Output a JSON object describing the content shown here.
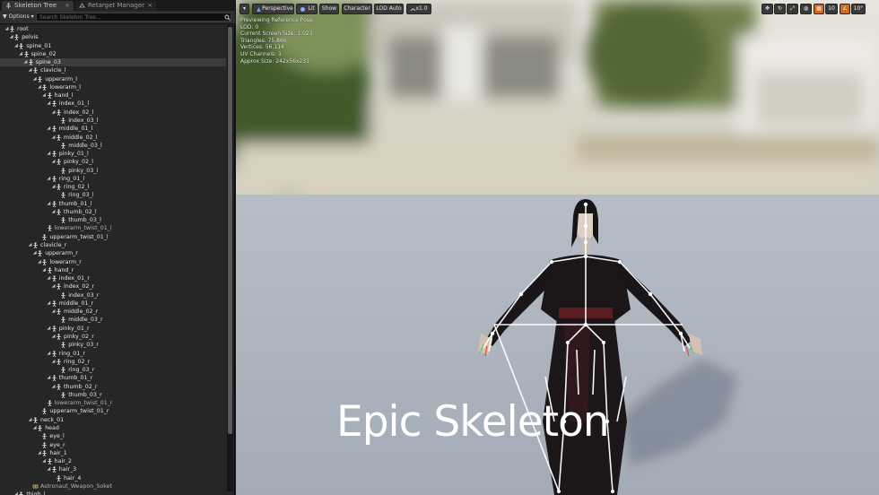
{
  "tabs": [
    {
      "label": "Skeleton Tree",
      "icon": "skeleton-tree-icon"
    },
    {
      "label": "Retarget Manager",
      "icon": "retarget-icon"
    }
  ],
  "toolbar": {
    "options_label": "Options",
    "search_placeholder": "Search Skeleton Tree..."
  },
  "tree": [
    {
      "label": "root",
      "depth": 0,
      "arrow": "open"
    },
    {
      "label": "pelvis",
      "depth": 1,
      "arrow": "open"
    },
    {
      "label": "spine_01",
      "depth": 2,
      "arrow": "open"
    },
    {
      "label": "spine_02",
      "depth": 3,
      "arrow": "open"
    },
    {
      "label": "spine_03",
      "depth": 4,
      "arrow": "open",
      "selected": true
    },
    {
      "label": "clavicle_l",
      "depth": 5,
      "arrow": "open"
    },
    {
      "label": "upperarm_l",
      "depth": 6,
      "arrow": "open"
    },
    {
      "label": "lowerarm_l",
      "depth": 7,
      "arrow": "open"
    },
    {
      "label": "hand_l",
      "depth": 8,
      "arrow": "open"
    },
    {
      "label": "index_01_l",
      "depth": 9,
      "arrow": "open"
    },
    {
      "label": "index_02_l",
      "depth": 10,
      "arrow": "open"
    },
    {
      "label": "index_03_l",
      "depth": 11,
      "arrow": "none"
    },
    {
      "label": "middle_01_l",
      "depth": 9,
      "arrow": "open"
    },
    {
      "label": "middle_02_l",
      "depth": 10,
      "arrow": "open"
    },
    {
      "label": "middle_03_l",
      "depth": 11,
      "arrow": "none"
    },
    {
      "label": "pinky_01_l",
      "depth": 9,
      "arrow": "open"
    },
    {
      "label": "pinky_02_l",
      "depth": 10,
      "arrow": "open"
    },
    {
      "label": "pinky_03_l",
      "depth": 11,
      "arrow": "none"
    },
    {
      "label": "ring_01_l",
      "depth": 9,
      "arrow": "open"
    },
    {
      "label": "ring_02_l",
      "depth": 10,
      "arrow": "open"
    },
    {
      "label": "ring_03_l",
      "depth": 11,
      "arrow": "none"
    },
    {
      "label": "thumb_01_l",
      "depth": 9,
      "arrow": "open"
    },
    {
      "label": "thumb_02_l",
      "depth": 10,
      "arrow": "open"
    },
    {
      "label": "thumb_03_l",
      "depth": 11,
      "arrow": "none"
    },
    {
      "label": "lowerarm_twist_01_l",
      "depth": 8,
      "arrow": "none",
      "dim": true
    },
    {
      "label": "upperarm_twist_01_l",
      "depth": 7,
      "arrow": "none"
    },
    {
      "label": "clavicle_r",
      "depth": 5,
      "arrow": "open"
    },
    {
      "label": "upperarm_r",
      "depth": 6,
      "arrow": "open"
    },
    {
      "label": "lowerarm_r",
      "depth": 7,
      "arrow": "open"
    },
    {
      "label": "hand_r",
      "depth": 8,
      "arrow": "open"
    },
    {
      "label": "index_01_r",
      "depth": 9,
      "arrow": "open"
    },
    {
      "label": "index_02_r",
      "depth": 10,
      "arrow": "open"
    },
    {
      "label": "index_03_r",
      "depth": 11,
      "arrow": "none"
    },
    {
      "label": "middle_01_r",
      "depth": 9,
      "arrow": "open"
    },
    {
      "label": "middle_02_r",
      "depth": 10,
      "arrow": "open"
    },
    {
      "label": "middle_03_r",
      "depth": 11,
      "arrow": "none"
    },
    {
      "label": "pinky_01_r",
      "depth": 9,
      "arrow": "open"
    },
    {
      "label": "pinky_02_r",
      "depth": 10,
      "arrow": "open"
    },
    {
      "label": "pinky_03_r",
      "depth": 11,
      "arrow": "none"
    },
    {
      "label": "ring_01_r",
      "depth": 9,
      "arrow": "open"
    },
    {
      "label": "ring_02_r",
      "depth": 10,
      "arrow": "open"
    },
    {
      "label": "ring_03_r",
      "depth": 11,
      "arrow": "none"
    },
    {
      "label": "thumb_01_r",
      "depth": 9,
      "arrow": "open"
    },
    {
      "label": "thumb_02_r",
      "depth": 10,
      "arrow": "open"
    },
    {
      "label": "thumb_03_r",
      "depth": 11,
      "arrow": "none"
    },
    {
      "label": "lowerarm_twist_01_r",
      "depth": 8,
      "arrow": "none",
      "dim": true
    },
    {
      "label": "upperarm_twist_01_r",
      "depth": 7,
      "arrow": "none"
    },
    {
      "label": "neck_01",
      "depth": 5,
      "arrow": "open"
    },
    {
      "label": "head",
      "depth": 6,
      "arrow": "open"
    },
    {
      "label": "eye_l",
      "depth": 7,
      "arrow": "none"
    },
    {
      "label": "eye_r",
      "depth": 7,
      "arrow": "none"
    },
    {
      "label": "hair_1",
      "depth": 7,
      "arrow": "open"
    },
    {
      "label": "hair_2",
      "depth": 8,
      "arrow": "open"
    },
    {
      "label": "hair_3",
      "depth": 9,
      "arrow": "open"
    },
    {
      "label": "hair_4",
      "depth": 10,
      "arrow": "none"
    },
    {
      "label": "Astronaut_Weapon_Soket",
      "depth": 5,
      "arrow": "none",
      "dim": true,
      "socket": true
    },
    {
      "label": "thigh_l",
      "depth": 2,
      "arrow": "open"
    }
  ],
  "viewport": {
    "perspective_label": "Perspective",
    "lit_label": "Lit",
    "show_label": "Show",
    "character_label": "Character",
    "lod_label": "LOD Auto",
    "speed_label": "x1.0",
    "info": [
      "Previewing Reference Pose",
      "LOD: 0",
      "Current Screen Size: 1.023",
      "Triangles: 75,866",
      "Vertices: 56,114",
      "UV Channels: 1",
      "Approx Size: 242x56x231"
    ],
    "grid_value": "10",
    "angle_value": "10°",
    "overlay_text": "Epic Skeleton"
  },
  "colors": {
    "panel_bg": "#262626",
    "selected_row": "#3c3c3c",
    "bone_icon": "#d8d8d8",
    "grid_snap_orange": "#d66a1b",
    "floor": "#aeb5bf"
  }
}
